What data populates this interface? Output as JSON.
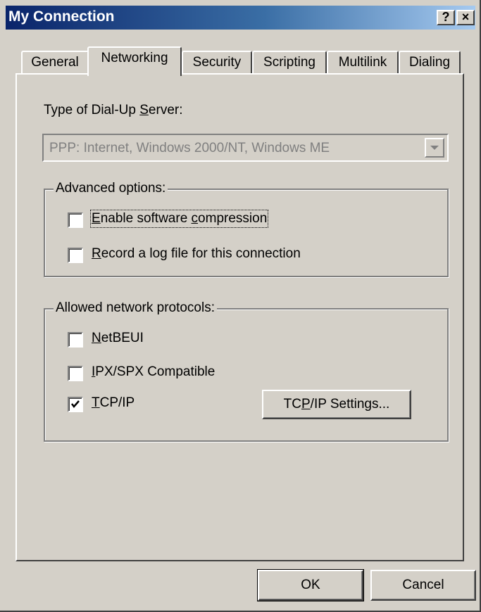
{
  "window": {
    "title": "My Connection",
    "help_label": "?",
    "close_label": "×"
  },
  "tabs": [
    {
      "label": "General",
      "active": false
    },
    {
      "label": "Networking",
      "active": true
    },
    {
      "label": "Security",
      "active": false
    },
    {
      "label": "Scripting",
      "active": false
    },
    {
      "label": "Multilink",
      "active": false
    },
    {
      "label": "Dialing",
      "active": false
    }
  ],
  "server_type": {
    "label_pre": "Type of Dial-Up ",
    "label_accel": "S",
    "label_post": "erver:",
    "value": "PPP: Internet, Windows 2000/NT, Windows ME",
    "disabled": true
  },
  "advanced": {
    "title": "Advanced options:",
    "compression": {
      "accel": "E",
      "rest_a": "nable software ",
      "accel2": "c",
      "rest_b": "ompression",
      "checked": false
    },
    "log": {
      "accel": "R",
      "rest": "ecord a log file for this connection",
      "checked": false
    }
  },
  "protocols": {
    "title": "Allowed network protocols:",
    "netbeui": {
      "accel": "N",
      "rest": "etBEUI",
      "checked": false
    },
    "ipx": {
      "accel": "I",
      "rest": "PX/SPX Compatible",
      "checked": false
    },
    "tcpip": {
      "accel": "T",
      "rest": "CP/IP",
      "checked": true
    },
    "settings_pre": "TC",
    "settings_accel": "P",
    "settings_post": "/IP Settings..."
  },
  "buttons": {
    "ok": "OK",
    "cancel": "Cancel"
  }
}
